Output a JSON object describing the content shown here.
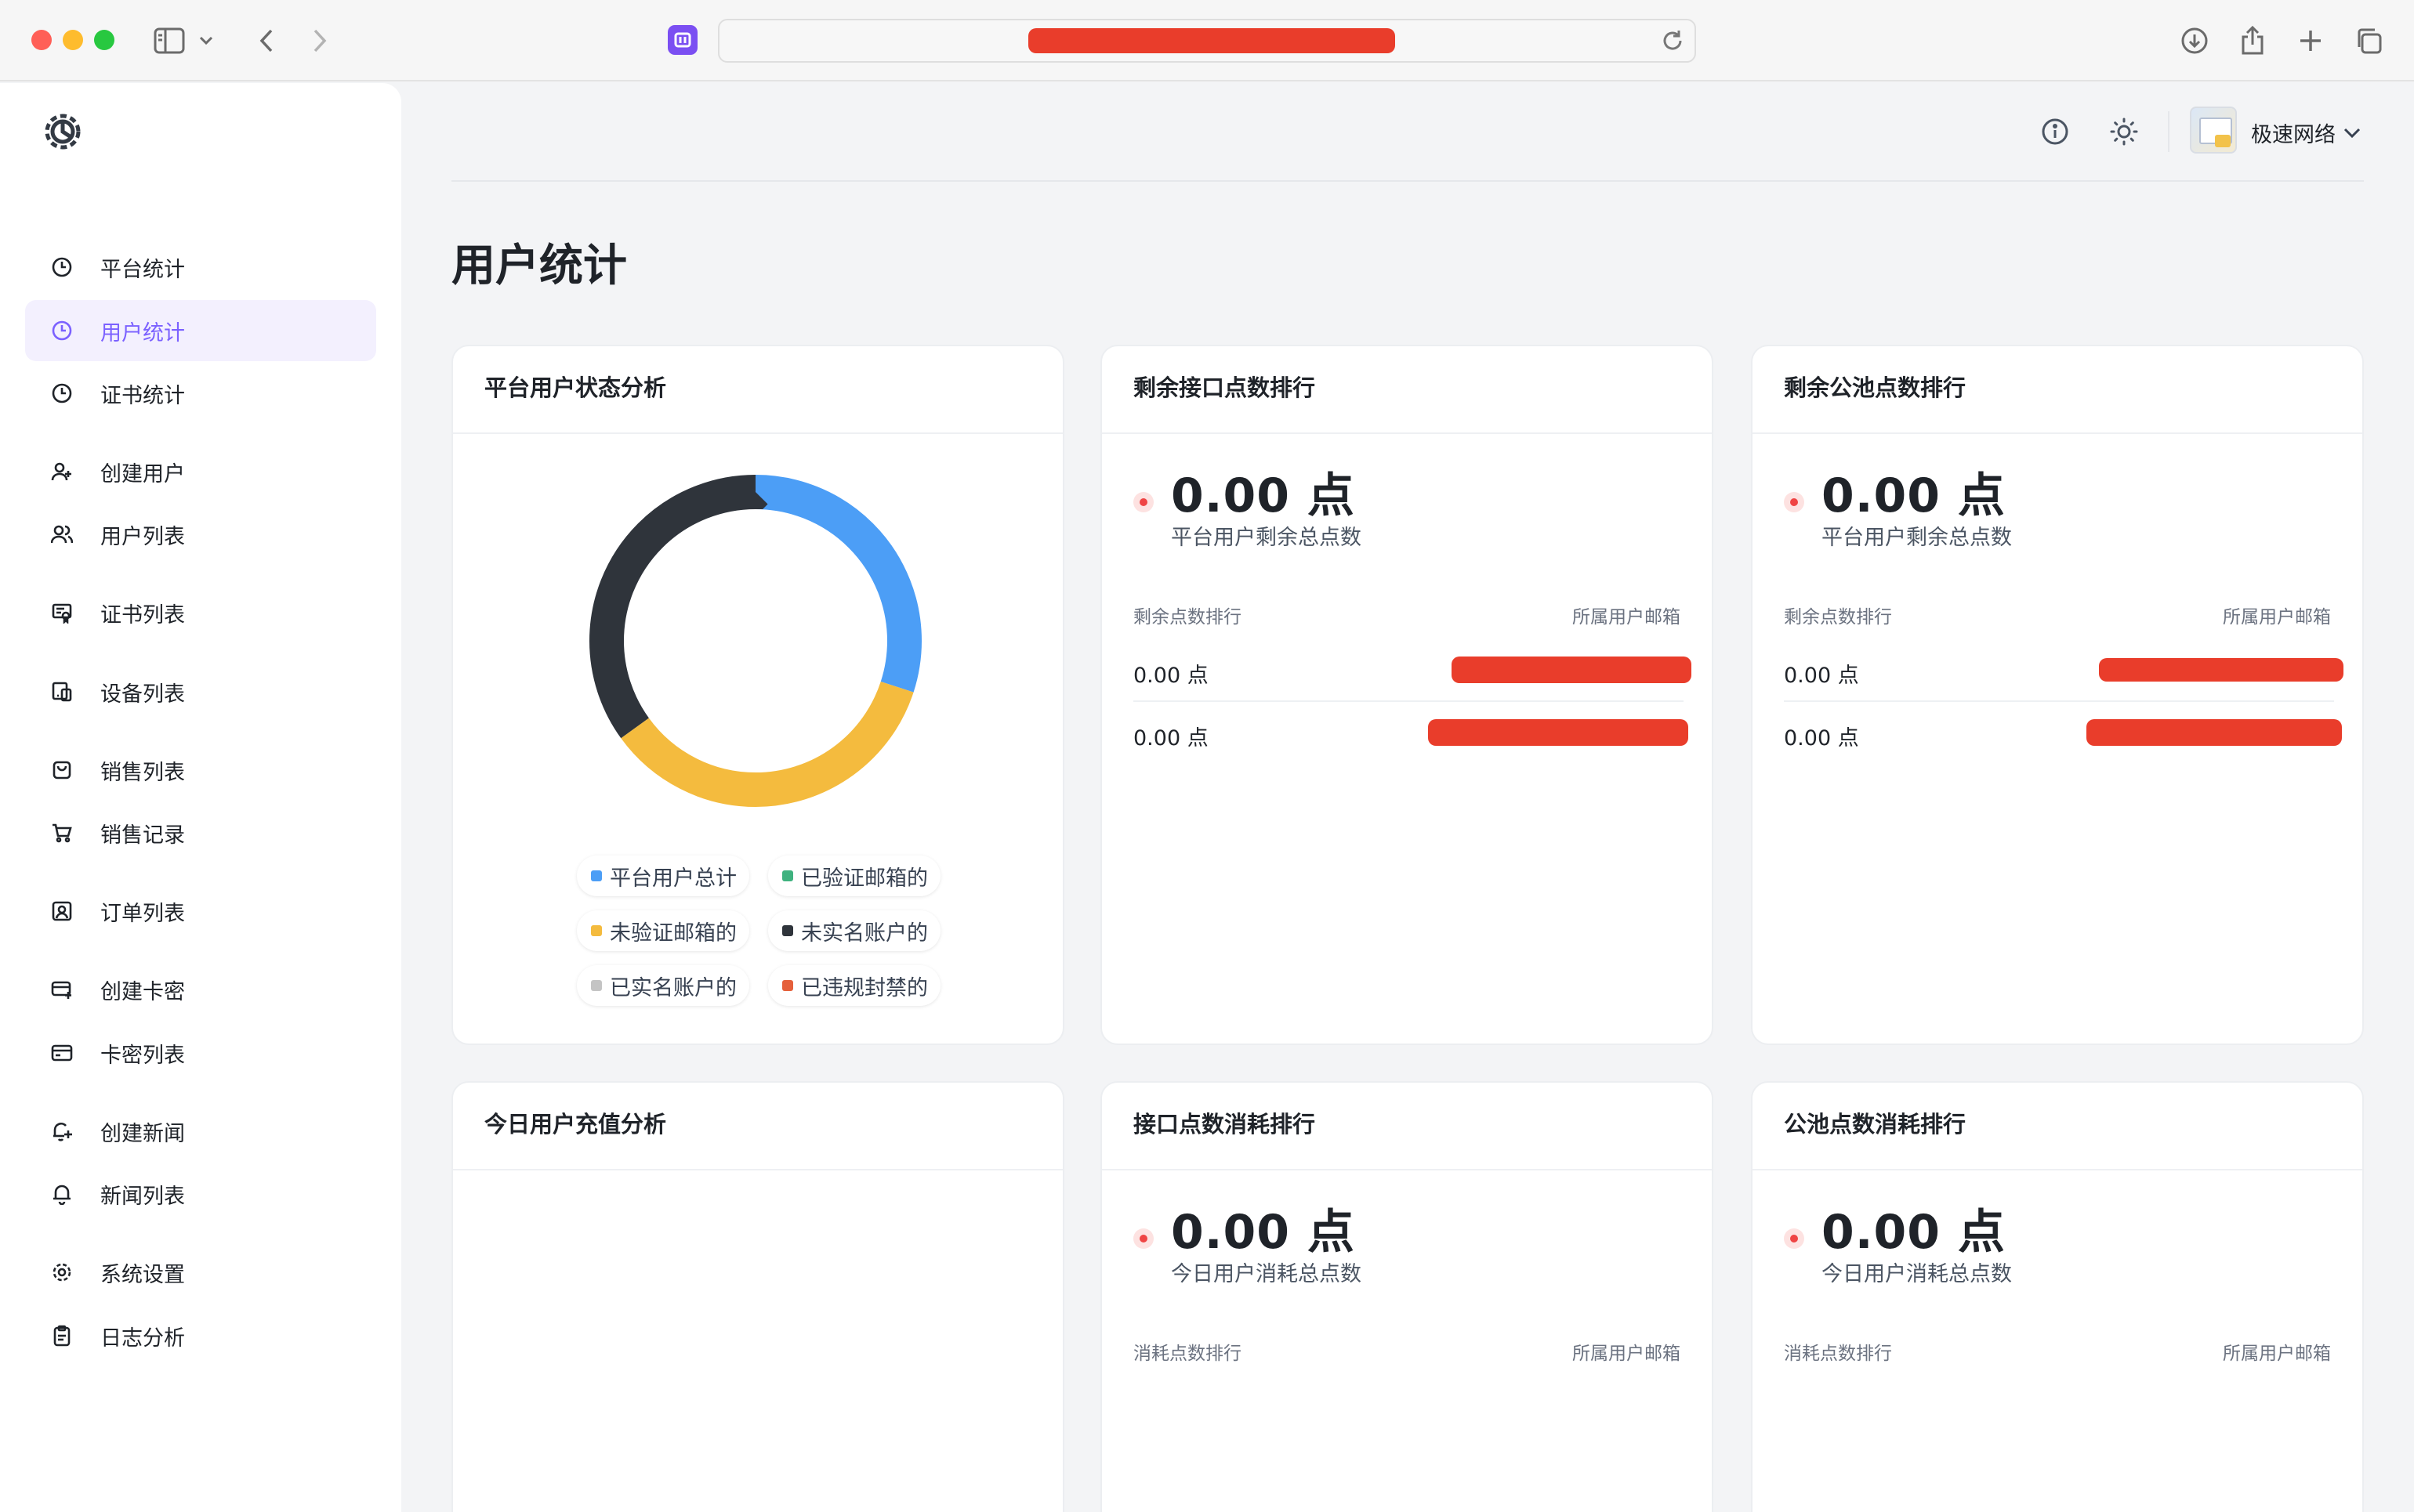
{
  "browser": {
    "address_value": "redacted"
  },
  "sidebar": {
    "items": [
      {
        "label": "平台统计",
        "icon": "clock-icon",
        "active": false
      },
      {
        "label": "用户统计",
        "icon": "clock-icon",
        "active": true
      },
      {
        "label": "证书统计",
        "icon": "clock-icon",
        "active": false
      },
      {
        "label": "创建用户",
        "icon": "user-plus-icon",
        "active": false
      },
      {
        "label": "用户列表",
        "icon": "users-icon",
        "active": false
      },
      {
        "label": "证书列表",
        "icon": "certificate-icon",
        "active": false
      },
      {
        "label": "设备列表",
        "icon": "device-icon",
        "active": false
      },
      {
        "label": "销售列表",
        "icon": "bag-icon",
        "active": false
      },
      {
        "label": "销售记录",
        "icon": "cart-icon",
        "active": false
      },
      {
        "label": "订单列表",
        "icon": "order-icon",
        "active": false
      },
      {
        "label": "创建卡密",
        "icon": "card-plus-icon",
        "active": false
      },
      {
        "label": "卡密列表",
        "icon": "card-icon",
        "active": false
      },
      {
        "label": "创建新闻",
        "icon": "bell-plus-icon",
        "active": false
      },
      {
        "label": "新闻列表",
        "icon": "bell-icon",
        "active": false
      },
      {
        "label": "系统设置",
        "icon": "gear-icon",
        "active": false
      },
      {
        "label": "日志分析",
        "icon": "clipboard-icon",
        "active": false
      }
    ]
  },
  "header": {
    "org_name": "极速网络"
  },
  "page": {
    "title": "用户统计"
  },
  "status_card": {
    "title": "平台用户状态分析",
    "legend": [
      {
        "label": "平台用户总计",
        "color": "#4c9ef6"
      },
      {
        "label": "已验证邮箱的",
        "color": "#3fb27f"
      },
      {
        "label": "未验证邮箱的",
        "color": "#f4bb3e"
      },
      {
        "label": "未实名账户的",
        "color": "#2f343b"
      },
      {
        "label": "已实名账户的",
        "color": "#c4c4c4"
      },
      {
        "label": "已违规封禁的",
        "color": "#e5603b"
      }
    ]
  },
  "chart_data": {
    "type": "pie",
    "title": "平台用户状态分析",
    "labels": [
      "平台用户总计",
      "已验证邮箱的",
      "未验证邮箱的",
      "未实名账户的",
      "已实名账户的",
      "已违规封禁的"
    ],
    "values": [
      30,
      0,
      35,
      35,
      0,
      0
    ],
    "colors": [
      "#4c9ef6",
      "#3fb27f",
      "#f4bb3e",
      "#2f343b",
      "#c4c4c4",
      "#e5603b"
    ],
    "legend": "bottom",
    "donut": true
  },
  "api_remaining": {
    "title": "剩余接口点数排行",
    "value": "0.00 点",
    "subtitle": "平台用户剩余总点数",
    "col_left": "剩余点数排行",
    "col_right": "所属用户邮箱",
    "rows": [
      {
        "value": "0.00 点",
        "email": "redacted"
      },
      {
        "value": "0.00 点",
        "email": "redacted"
      }
    ]
  },
  "pool_remaining": {
    "title": "剩余公池点数排行",
    "value": "0.00 点",
    "subtitle": "平台用户剩余总点数",
    "col_left": "剩余点数排行",
    "col_right": "所属用户邮箱",
    "rows": [
      {
        "value": "0.00 点",
        "email": "redacted"
      },
      {
        "value": "0.00 点",
        "email": "redacted"
      }
    ]
  },
  "recharge_card": {
    "title": "今日用户充值分析"
  },
  "api_consume": {
    "title": "接口点数消耗排行",
    "value": "0.00 点",
    "subtitle": "今日用户消耗总点数",
    "col_left": "消耗点数排行",
    "col_right": "所属用户邮箱"
  },
  "pool_consume": {
    "title": "公池点数消耗排行",
    "value": "0.00 点",
    "subtitle": "今日用户消耗总点数",
    "col_left": "消耗点数排行",
    "col_right": "所属用户邮箱"
  }
}
